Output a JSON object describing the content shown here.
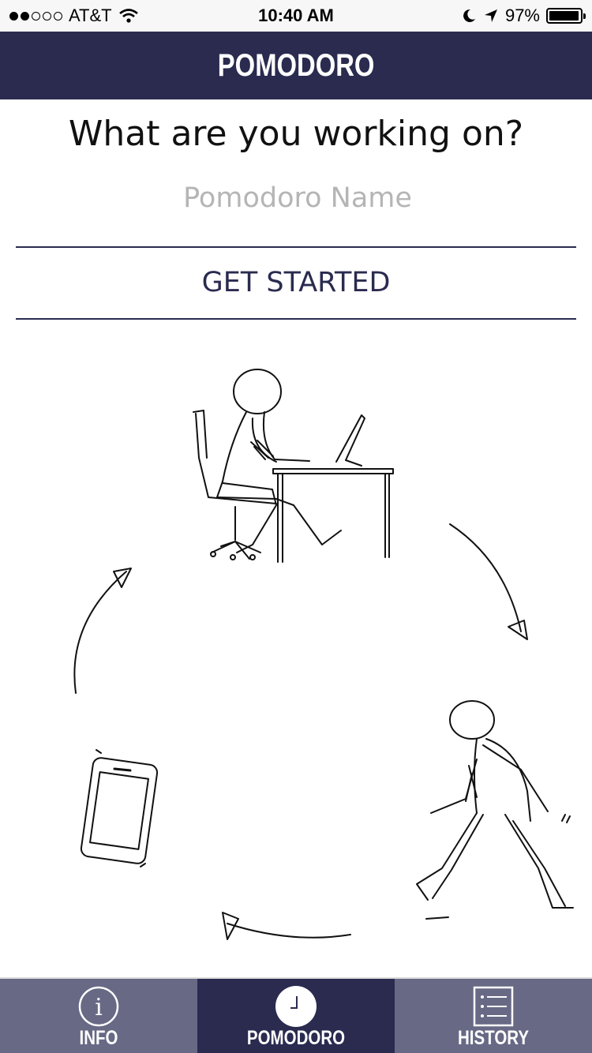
{
  "status_bar": {
    "carrier": "AT&T",
    "time": "10:40 AM",
    "battery": "97%",
    "battery_level": 0.97,
    "signal_bars_filled": 2,
    "signal_bars_total": 5
  },
  "nav": {
    "title": "POMODORO"
  },
  "main": {
    "question": "What are you working on?",
    "name_placeholder": "Pomodoro Name",
    "name_value": "",
    "start_label": "GET STARTED"
  },
  "tabs": [
    {
      "label": "INFO",
      "icon": "info-icon",
      "active": false
    },
    {
      "label": "POMODORO",
      "icon": "clock-icon",
      "active": true
    },
    {
      "label": "HISTORY",
      "icon": "list-icon",
      "active": false
    }
  ],
  "colors": {
    "primary": "#2a2b4f",
    "tab_inactive": "#676985",
    "placeholder": "#b5b5b5"
  }
}
